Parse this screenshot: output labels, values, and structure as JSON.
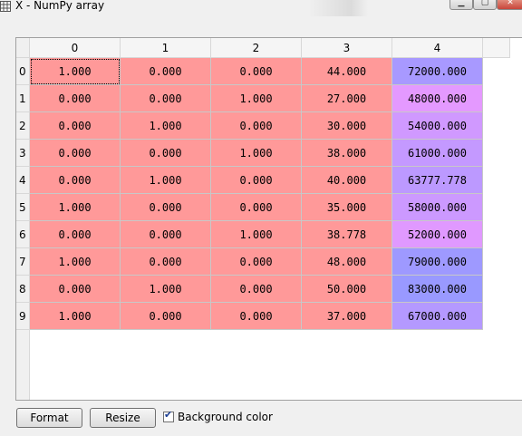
{
  "window": {
    "title": "X - NumPy array",
    "icon": "grid-icon",
    "buttons": [
      "minimize-icon",
      "maximize-icon",
      "close-icon"
    ]
  },
  "table": {
    "columns": [
      "0",
      "1",
      "2",
      "3",
      "4"
    ],
    "rows": [
      "0",
      "1",
      "2",
      "3",
      "4",
      "5",
      "6",
      "7",
      "8",
      "9"
    ],
    "cells": [
      [
        "1.000",
        "0.000",
        "0.000",
        "44.000",
        "72000.000"
      ],
      [
        "0.000",
        "0.000",
        "1.000",
        "27.000",
        "48000.000"
      ],
      [
        "0.000",
        "1.000",
        "0.000",
        "30.000",
        "54000.000"
      ],
      [
        "0.000",
        "0.000",
        "1.000",
        "38.000",
        "61000.000"
      ],
      [
        "0.000",
        "1.000",
        "0.000",
        "40.000",
        "63777.778"
      ],
      [
        "1.000",
        "0.000",
        "0.000",
        "35.000",
        "58000.000"
      ],
      [
        "0.000",
        "0.000",
        "1.000",
        "38.778",
        "52000.000"
      ],
      [
        "1.000",
        "0.000",
        "0.000",
        "48.000",
        "79000.000"
      ],
      [
        "0.000",
        "1.000",
        "0.000",
        "50.000",
        "83000.000"
      ],
      [
        "1.000",
        "0.000",
        "0.000",
        "37.000",
        "67000.000"
      ]
    ],
    "cell_colors": [
      [
        "#ff9999",
        "#ff9999",
        "#ff9999",
        "#ff9999",
        "#a899ff"
      ],
      [
        "#ff9999",
        "#ff9999",
        "#ff9999",
        "#ff9999",
        "#e499ff"
      ],
      [
        "#ff9999",
        "#ff9999",
        "#ff9999",
        "#ff9999",
        "#d099ff"
      ],
      [
        "#ff9999",
        "#ff9999",
        "#ff9999",
        "#ff9999",
        "#c499ff"
      ],
      [
        "#ff9999",
        "#ff9999",
        "#ff9999",
        "#ff9999",
        "#bc99ff"
      ],
      [
        "#ff9999",
        "#ff9999",
        "#ff9999",
        "#ff9999",
        "#cc99ff"
      ],
      [
        "#ff9999",
        "#ff9999",
        "#ff9999",
        "#ff9999",
        "#e099ff"
      ],
      [
        "#ff9999",
        "#ff9999",
        "#ff9999",
        "#ff9999",
        "#9e99ff"
      ],
      [
        "#ff9999",
        "#ff9999",
        "#ff9999",
        "#ff9999",
        "#9999ff"
      ],
      [
        "#ff9999",
        "#ff9999",
        "#ff9999",
        "#ff9999",
        "#b499ff"
      ]
    ],
    "selected_cell": [
      0,
      0
    ]
  },
  "footer": {
    "format_label": "Format",
    "resize_label": "Resize",
    "background_label": "Background color",
    "background_checked": true
  }
}
